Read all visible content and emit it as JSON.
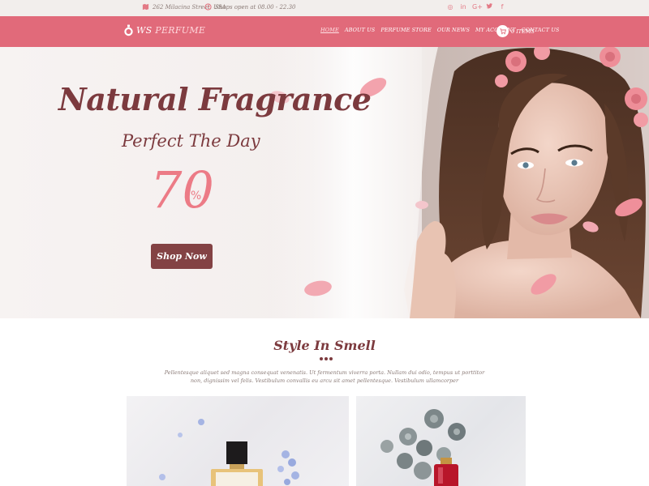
{
  "topbar": {
    "address": "262 Milacina Street, USA",
    "hours": "Shops open at 08.00 - 22.30",
    "socials": [
      {
        "name": "instagram-icon",
        "glyph": "◎"
      },
      {
        "name": "linkedin-icon",
        "glyph": "in"
      },
      {
        "name": "google-plus-icon",
        "glyph": "G+"
      },
      {
        "name": "twitter-icon",
        "glyph": "🐦"
      },
      {
        "name": "facebook-icon",
        "glyph": "f"
      }
    ]
  },
  "brand": {
    "logo_ws": "WS",
    "logo_perfume": "PERFUME"
  },
  "nav": {
    "items": [
      "HOME",
      "ABOUT US",
      "PERFUME STORE",
      "OUR NEWS",
      "MY ACCOUNT",
      "CONTACT US"
    ],
    "active": "HOME",
    "cart_label": "0 ITEMS"
  },
  "hero": {
    "title": "Natural Fragrance",
    "subtitle": "Perfect The Day",
    "percent": "70",
    "percent_sign": "%",
    "button": "Shop Now"
  },
  "section": {
    "title": "Style In Smell",
    "description": "Pellentesque aliquet sed magna consequat venenatis. Ut fermentum viverra porta. Nullam dui odio, tempus ut porttitor non, dignissim vel felis. Vestibulum convallis eu arcu sit amet pellentesque. Vestibulum ullamcorper"
  },
  "colors": {
    "topbar_bg": "#f2eeec",
    "nav_bg": "#e16a7a",
    "title_color": "#7c3a3e",
    "accent_pink": "#ec7b86",
    "button_bg": "#834244"
  }
}
